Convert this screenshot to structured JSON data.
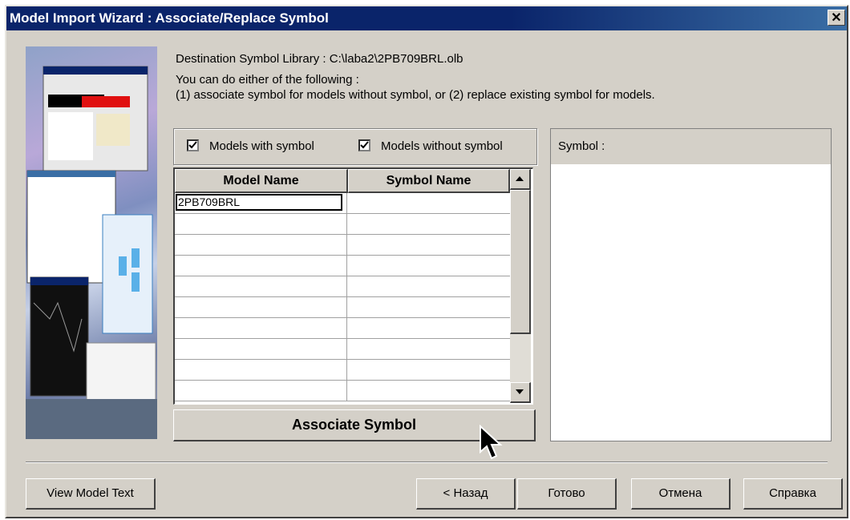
{
  "window": {
    "title": "Model Import Wizard : Associate/Replace Symbol"
  },
  "info": {
    "destination": "Destination Symbol Library :  C:\\laba2\\2PB709BRL.olb",
    "line1": "You can do either of the following :",
    "line2": "(1) associate symbol for models without symbol, or (2) replace existing symbol for models."
  },
  "filters": {
    "with_symbol": {
      "label": "Models with symbol",
      "checked": true
    },
    "without_symbol": {
      "label": "Models without symbol",
      "checked": true
    }
  },
  "table": {
    "columns": [
      "Model Name",
      "Symbol Name"
    ],
    "rows": [
      {
        "model": "2PB709BRL",
        "symbol": ""
      },
      {
        "model": "",
        "symbol": ""
      },
      {
        "model": "",
        "symbol": ""
      },
      {
        "model": "",
        "symbol": ""
      },
      {
        "model": "",
        "symbol": ""
      },
      {
        "model": "",
        "symbol": ""
      },
      {
        "model": "",
        "symbol": ""
      },
      {
        "model": "",
        "symbol": ""
      },
      {
        "model": "",
        "symbol": ""
      },
      {
        "model": "",
        "symbol": ""
      }
    ]
  },
  "associate_button": "Associate Symbol",
  "symbol_panel": {
    "label": "Symbol :"
  },
  "footer": {
    "view_model_text": "View Model Text",
    "back": "< Назад",
    "finish": "Готово",
    "cancel": "Отмена",
    "help": "Справка"
  },
  "icons": {
    "close": "close-icon",
    "checkbox": "check-icon",
    "scroll_up": "arrow-up-icon",
    "scroll_down": "arrow-down-icon",
    "cursor": "mouse-pointer-icon"
  }
}
